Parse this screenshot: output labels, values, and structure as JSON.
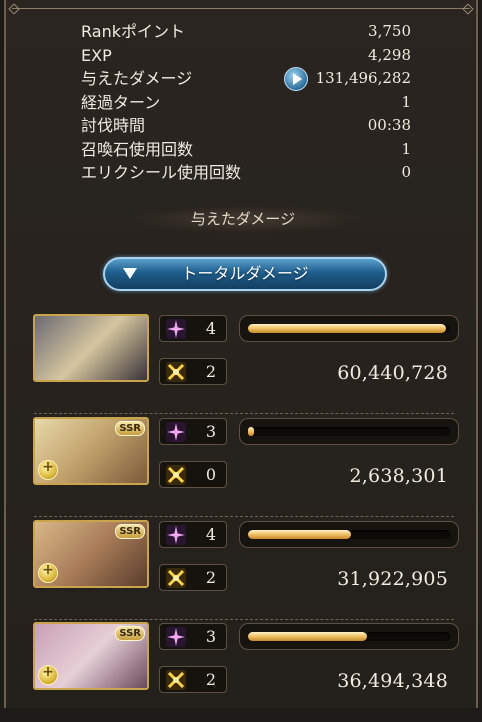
{
  "stats": [
    {
      "label": "Rankポイント",
      "value": "3,750"
    },
    {
      "label": "EXP",
      "value": "4,298"
    },
    {
      "label": "与えたダメージ",
      "value": "131,496,282"
    },
    {
      "label": "経過ターン",
      "value": "1"
    },
    {
      "label": "討伐時間",
      "value": "00:38"
    },
    {
      "label": "召喚石使用回数",
      "value": "1"
    },
    {
      "label": "エリクシール使用回数",
      "value": "0"
    }
  ],
  "section_title": "与えたダメージ",
  "dropdown": {
    "selected": "トータルダメージ"
  },
  "members": [
    {
      "name": "character-1",
      "ssr": "",
      "stars": "4",
      "swords": "2",
      "damage": "60,440,728",
      "bar_fraction": 0.98,
      "portrait_colors": [
        "#6a6a72",
        "#d6c6a0",
        "#3a3338"
      ]
    },
    {
      "name": "character-2",
      "ssr": "SSR",
      "stars": "3",
      "swords": "0",
      "damage": "2,638,301",
      "bar_fraction": 0.03,
      "portrait_colors": [
        "#e8d8a8",
        "#bfa06a",
        "#7a5a3a"
      ]
    },
    {
      "name": "character-3",
      "ssr": "SSR",
      "stars": "4",
      "swords": "2",
      "damage": "31,922,905",
      "bar_fraction": 0.51,
      "portrait_colors": [
        "#d8b888",
        "#a87c58",
        "#5a3c2c"
      ]
    },
    {
      "name": "character-4",
      "ssr": "SSR",
      "stars": "3",
      "swords": "2",
      "damage": "36,494,348",
      "bar_fraction": 0.59,
      "portrait_colors": [
        "#c8a0b4",
        "#e6cfd6",
        "#6a4a5a"
      ]
    }
  ]
}
